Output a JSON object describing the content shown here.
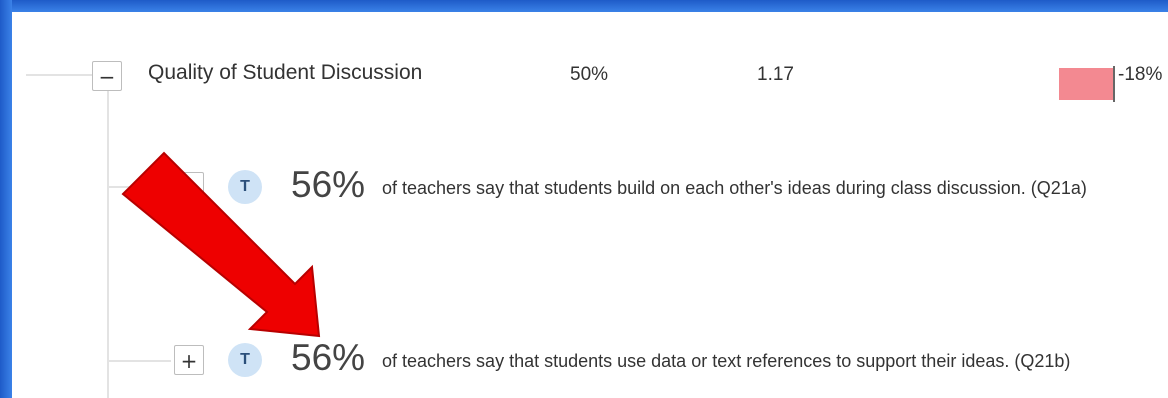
{
  "category_row": {
    "toggle": "−",
    "label": "Quality of Student Discussion",
    "percent": "50%",
    "score": "1.17",
    "difference": "-18%",
    "difference_value": -18,
    "difference_color": "#f38991"
  },
  "items": [
    {
      "toggle": "+",
      "badge": "T",
      "percent": "56%",
      "text": "of teachers say that students build on each other's ideas during class discussion. (Q21a)"
    },
    {
      "toggle": "+",
      "badge": "T",
      "percent": "56%",
      "text": "of teachers say that students use data or text references to support their ideas. (Q21b)"
    }
  ],
  "colors": {
    "frame": "#2f6fd6",
    "badge": "#cfe3f6",
    "arrow": "#ee0000"
  }
}
